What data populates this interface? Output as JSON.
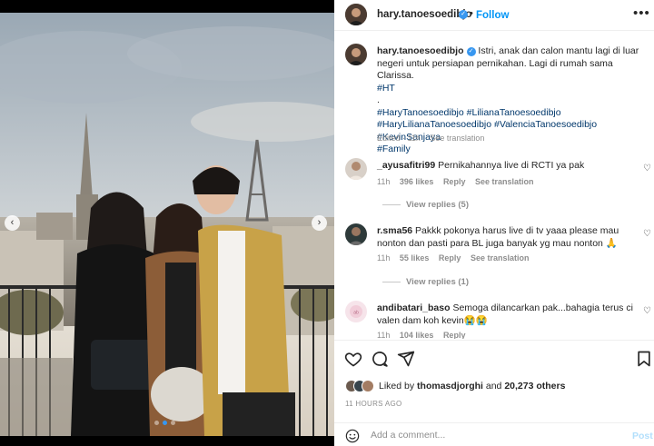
{
  "post": {
    "username": "hary.tanoesoedibjo",
    "header_separator": "•",
    "follow_label": "Follow",
    "more_icon": "more-horizontal-icon",
    "caption": {
      "text": "Istri, anak dan calon mantu lagi di luar negeri untuk persiapan pernikahan. Lagi di rumah sama Clarissa.",
      "line_tag": "#HT",
      "dot": ".",
      "hashtags": [
        "#HaryTanoesoedibjo",
        "#LilianaTanoesoedibjo",
        "#HaryLilianaTanoesoedibjo",
        "#ValenciaTanoesoedibjo",
        "#KevinSanjaya",
        "#Family"
      ],
      "edited_label": "Edited · 11h",
      "see_translation": "See translation"
    }
  },
  "comments": [
    {
      "username": "_ayusafitri99",
      "text": "Pernikahannya live di RCTI ya pak",
      "time": "11h",
      "likes": "396 likes",
      "reply": "Reply",
      "see_translation": "See translation",
      "view_replies": "View replies (5)"
    },
    {
      "username": "r.sma56",
      "text": "Pakkk pokonya harus live di tv yaaa please mau nonton dan pasti para BL juga banyak yg mau nonton 🙏",
      "time": "11h",
      "likes": "55 likes",
      "reply": "Reply",
      "see_translation": "See translation",
      "view_replies": "View replies (1)"
    },
    {
      "username": "andibatari_baso",
      "text": "Semoga dilancarkan pak...bahagia terus ci valen dam koh kevin😭😭",
      "time": "11h",
      "likes": "104 likes",
      "reply": "Reply"
    }
  ],
  "actions": {
    "like_icon": "heart-icon",
    "comment_icon": "comment-icon",
    "share_icon": "send-icon",
    "save_icon": "bookmark-icon",
    "liked_by_prefix": "Liked by",
    "liked_by_user": "thomasdjorghi",
    "liked_by_and": "and",
    "liked_by_others": "20,273 others",
    "time_ago": "11 HOURS AGO"
  },
  "comment_input": {
    "placeholder": "Add a comment...",
    "post_label": "Post"
  },
  "media": {
    "carousel_dots": 3,
    "active_dot": 1
  },
  "colors": {
    "accent": "#0095f6",
    "hashtag": "#00376b",
    "muted": "#8e8e8e"
  }
}
